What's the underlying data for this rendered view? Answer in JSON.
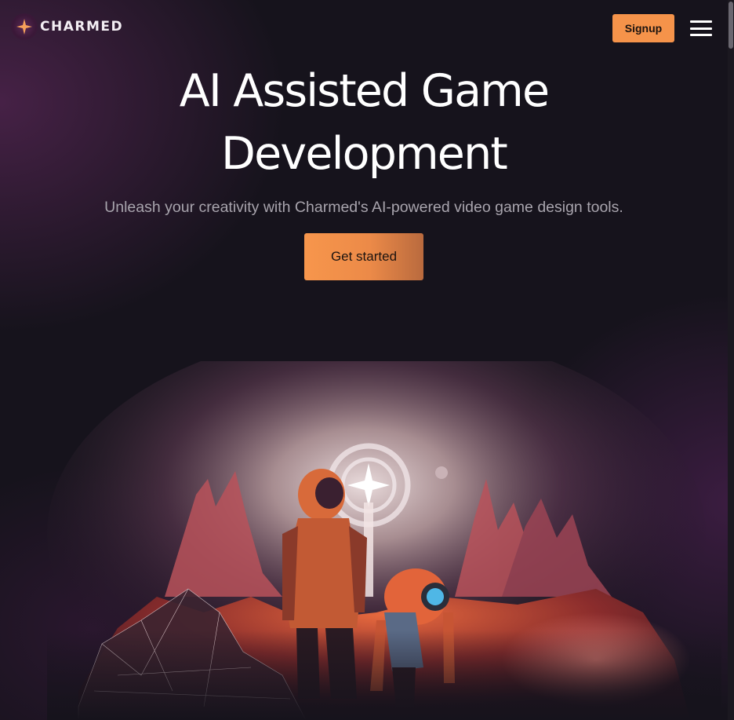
{
  "header": {
    "logo_text": "CHARMED",
    "signup_label": "Signup"
  },
  "hero": {
    "title_line1": "AI Assisted Game",
    "title_line2": "Development",
    "subtitle": "Unleash your creativity with Charmed's AI-powered video game design tools.",
    "cta_label": "Get started"
  },
  "icons": {
    "logo": "sparkle-star-icon",
    "menu": "hamburger-menu-icon"
  },
  "colors": {
    "background": "#16131c",
    "accent": "#f5934a",
    "subtitle": "#a8a4ad"
  }
}
